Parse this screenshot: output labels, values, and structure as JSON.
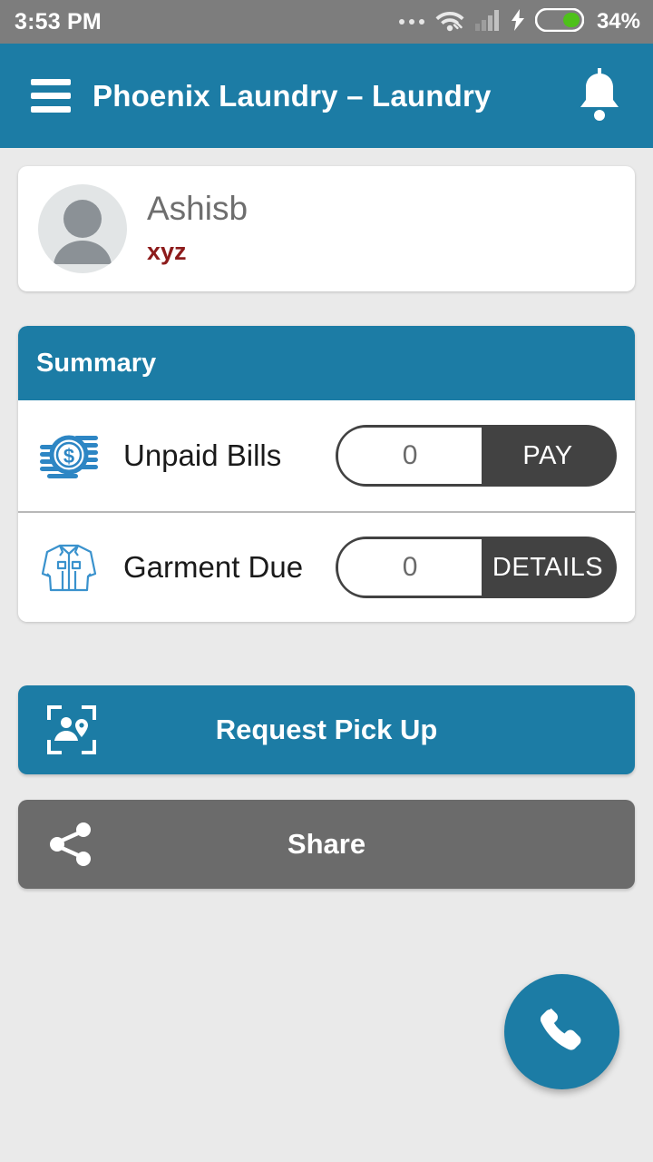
{
  "status_bar": {
    "time": "3:53 PM",
    "battery_percent": "34%",
    "icons": [
      "more-dots-icon",
      "wifi-icon",
      "signal-bars-icon",
      "charging-bolt-icon",
      "battery-icon"
    ],
    "background_color": "#7d7d7d"
  },
  "app_bar": {
    "menu_icon": "hamburger-menu-icon",
    "title": "Phoenix Laundry – Laundry",
    "notification_icon": "bell-icon",
    "background_color": "#1c7ca5"
  },
  "profile": {
    "avatar_icon": "user-avatar-placeholder-icon",
    "name": "Ashisb",
    "subtitle": "xyz",
    "subtitle_color": "#8d1b1b"
  },
  "summary": {
    "header": "Summary",
    "rows": [
      {
        "icon": "coins-money-icon",
        "label": "Unpaid Bills",
        "value": "0",
        "action": "PAY"
      },
      {
        "icon": "jacket-garment-icon",
        "label": "Garment Due",
        "value": "0",
        "action": "DETAILS"
      }
    ]
  },
  "actions": [
    {
      "icon": "pickup-location-scan-icon",
      "label": "Request Pick Up",
      "color": "#1c7ca5"
    },
    {
      "icon": "share-nodes-icon",
      "label": "Share",
      "color": "#6b6b6b"
    }
  ],
  "fab": {
    "icon": "phone-call-icon",
    "color": "#1c7ca5"
  },
  "theme": {
    "accent": "#1c7ca5",
    "page_background": "#eaeaea",
    "dark_button": "#424242"
  }
}
